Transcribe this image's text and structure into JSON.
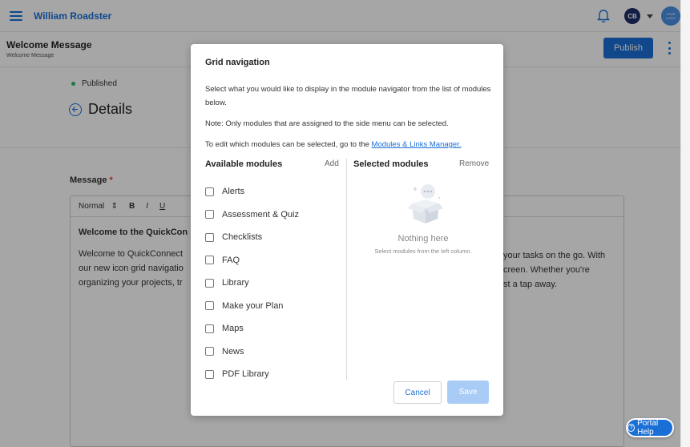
{
  "topbar": {
    "user_name": "William Roadster",
    "avatar_initials": "CB",
    "logo_text": "YOUR LOGO"
  },
  "page_header": {
    "title": "Welcome Message",
    "subtitle": "Welcome Message",
    "publish_label": "Publish"
  },
  "content": {
    "status": "Published",
    "section_title": "Details",
    "message_label": "Message",
    "required_mark": "*",
    "editor_toolbar": {
      "style_select": "Normal",
      "bold": "B",
      "italic": "I",
      "underline": "U"
    },
    "editor_heading": "Welcome to the QuickCon",
    "editor_left_lines": [
      "Welcome to QuickConnect",
      "our new icon grid navigatio",
      "organizing your projects, tr"
    ],
    "editor_right_lines": [
      "your tasks on the go. With",
      "creen. Whether you're",
      "st a tap away."
    ]
  },
  "modal": {
    "title": "Grid navigation",
    "description": "Select what you would like to display in the module navigator from the list of modules below.",
    "note": "Note: Only modules that are assigned to the side menu can be selected.",
    "link_prefix": "To edit which modules can be selected, go to the ",
    "link_text": "Modules & Links Manager.",
    "available_heading": "Available modules",
    "add_label": "Add",
    "selected_heading": "Selected modules",
    "remove_label": "Remove",
    "modules": [
      "Alerts",
      "Assessment & Quiz",
      "Checklists",
      "FAQ",
      "Library",
      "Make your Plan",
      "Maps",
      "News",
      "PDF Library"
    ],
    "empty_title": "Nothing here",
    "empty_subtitle": "Select modules from the left column.",
    "cancel_label": "Cancel",
    "save_label": "Save"
  },
  "portal_help": {
    "label": "Portal Help"
  },
  "colors": {
    "accent": "#1a6fd6",
    "published_dot": "#2dbb6a",
    "save_disabled": "#a9ccf7"
  }
}
